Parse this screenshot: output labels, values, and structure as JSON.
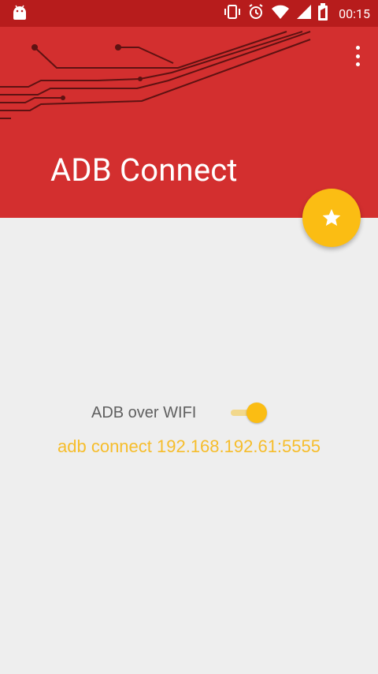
{
  "status_bar": {
    "time": "00:15",
    "icons": [
      "android-icon",
      "vibrate-icon",
      "alarm-icon",
      "wifi-icon",
      "signal-icon",
      "battery-icon"
    ]
  },
  "app_bar": {
    "title": "ADB Connect",
    "menu_icon": "overflow-menu-icon",
    "color": "#d32f2f"
  },
  "fab": {
    "icon": "star-icon",
    "color": "#fbbd13"
  },
  "content": {
    "toggle_label": "ADB over WIFI",
    "toggle_state": true,
    "command": "adb connect 192.168.192.61:5555",
    "accent_color": "#fbbd13"
  }
}
